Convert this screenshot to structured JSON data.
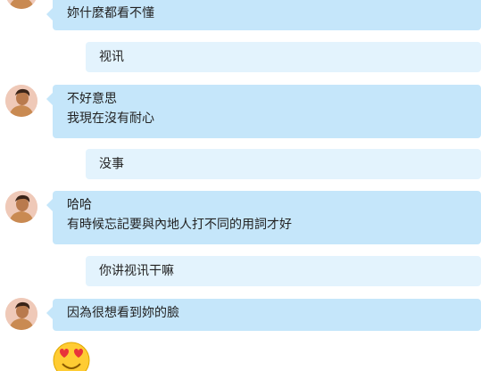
{
  "messages": [
    {
      "from": "them",
      "lines": [
        "妳什麼都看不懂"
      ]
    },
    {
      "from": "me",
      "lines": [
        "视讯"
      ]
    },
    {
      "from": "them",
      "lines": [
        "不好意思",
        "我現在沒有耐心"
      ]
    },
    {
      "from": "me",
      "lines": [
        "没事"
      ]
    },
    {
      "from": "them",
      "lines": [
        "哈哈",
        "有時候忘記要與內地人打不同的用詞才好"
      ]
    },
    {
      "from": "me",
      "lines": [
        "你讲视讯干嘛"
      ]
    },
    {
      "from": "them",
      "lines": [
        "因為很想看到妳的臉"
      ]
    },
    {
      "from": "them",
      "sticker": "heart-eyes-emoji-icon"
    }
  ],
  "colors": {
    "incoming_bubble": "#c5e6fa",
    "outgoing_bubble": "#e3f3fd",
    "text": "#222222"
  }
}
